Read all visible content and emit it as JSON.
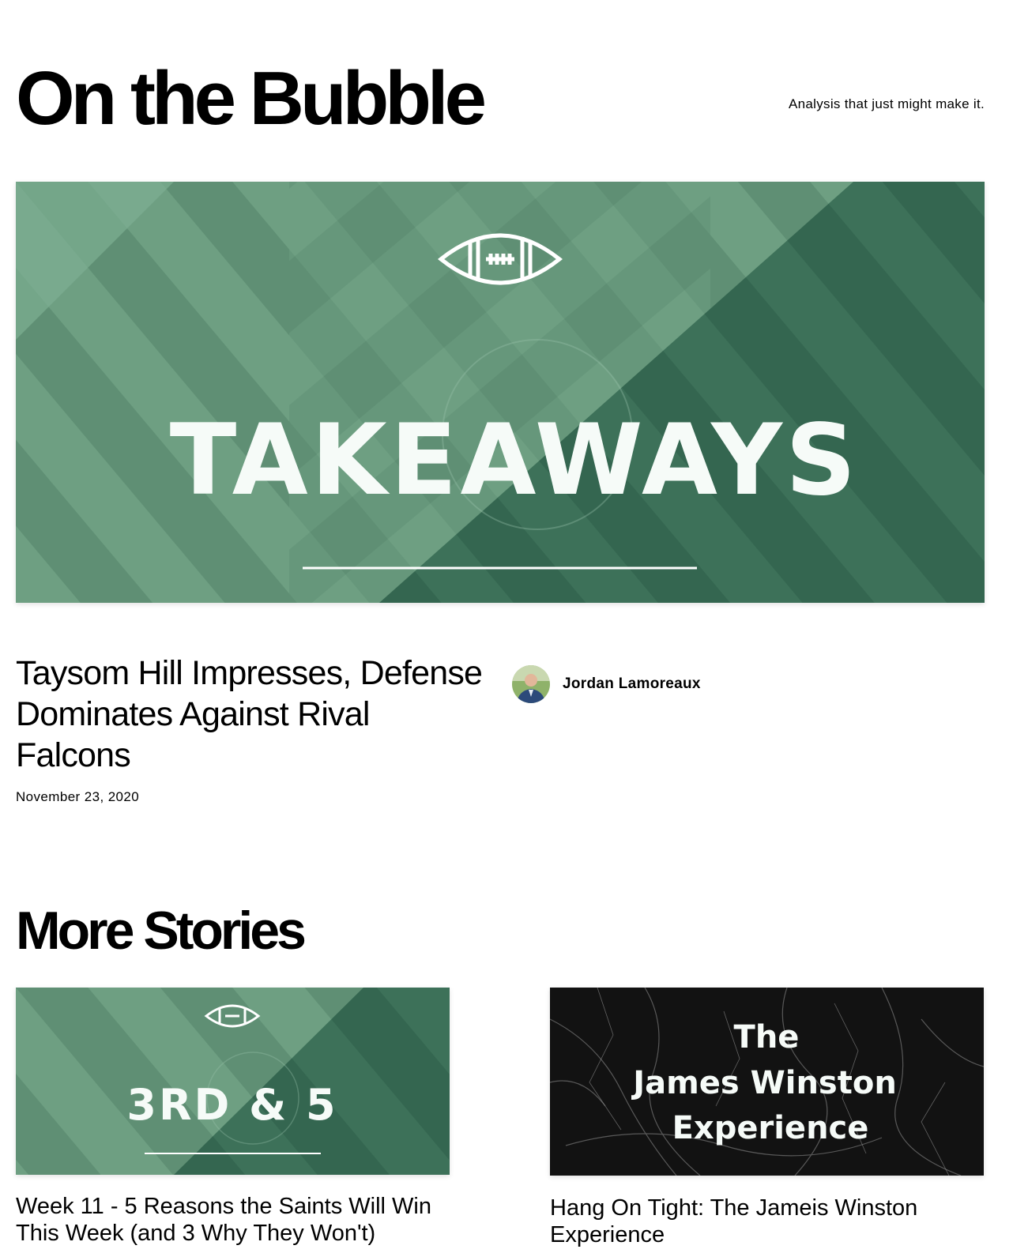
{
  "site": {
    "title": "On the Bubble",
    "tagline": "Analysis that just might make it."
  },
  "colors": {
    "field_light": "#6fa284",
    "field_dark": "#356b53",
    "text": "#000000",
    "card2_background": "#111111"
  },
  "featured": {
    "image_text": "TAKEAWAYS",
    "image_icon": "football-icon",
    "title": "Taysom Hill Impresses, Defense Dominates Against Rival Falcons",
    "date": "November 23, 2020",
    "author": "Jordan Lamoreaux"
  },
  "more_stories": {
    "heading": "More Stories",
    "cards": [
      {
        "image_text": "3RD & 5",
        "image_icon": "football-icon",
        "title": "Week 11 - 5 Reasons the Saints Will Win This Week (and 3 Why They Won't)"
      },
      {
        "image_lines": [
          "The",
          "James Winston",
          "Experience"
        ],
        "title": "Hang On Tight: The Jameis Winston Experience"
      }
    ]
  }
}
